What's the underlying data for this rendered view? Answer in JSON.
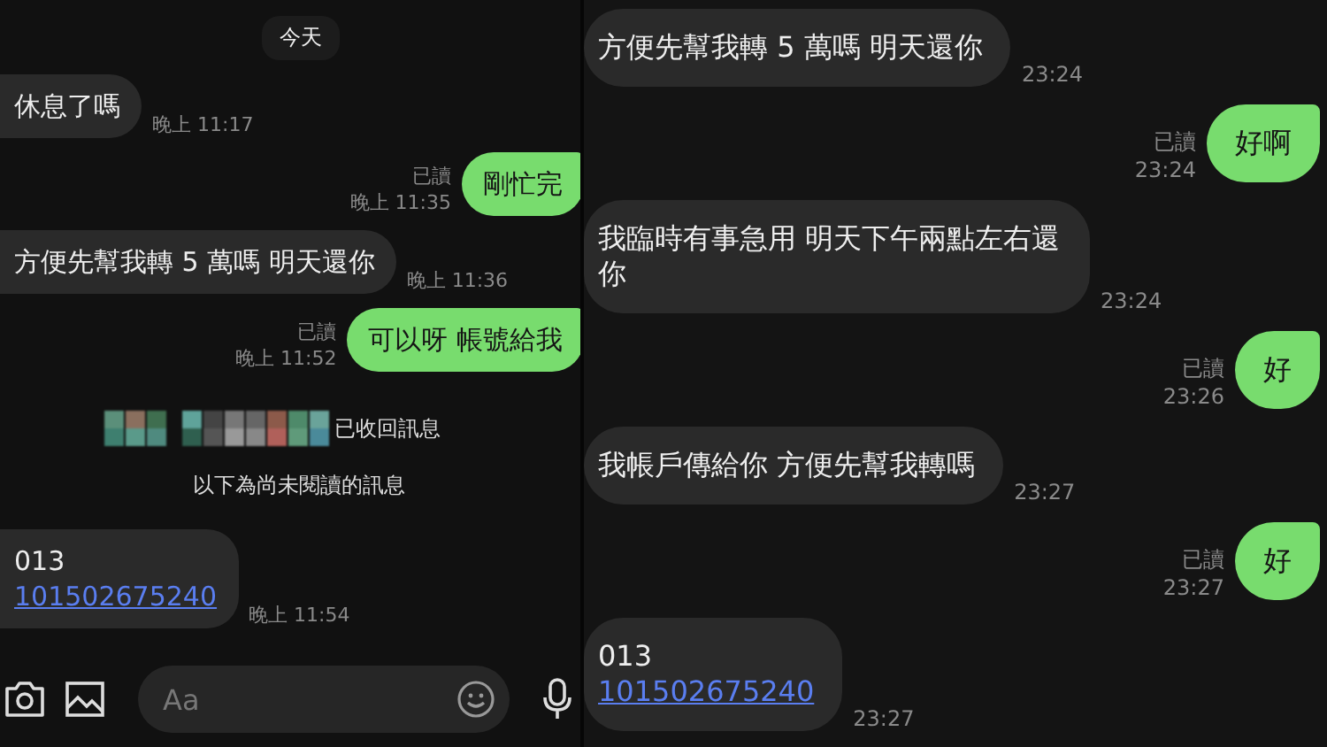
{
  "left_chat": {
    "messages": [
      {
        "kind": "date",
        "text": "今天"
      },
      {
        "kind": "received",
        "text": "休息了嗎",
        "time": "晚上 11:17"
      },
      {
        "kind": "sent",
        "text": "剛忙完",
        "read_label": "已讀",
        "time": "晚上 11:35"
      },
      {
        "kind": "received",
        "text": "方便先幫我轉 5 萬嗎 明天還你",
        "time": "晚上 11:36"
      },
      {
        "kind": "sent",
        "text": "可以呀 帳號給我",
        "read_label": "已讀",
        "time": "晚上 11:52"
      },
      {
        "kind": "recall",
        "text": "已收回訊息"
      },
      {
        "kind": "divider",
        "text": "以下為尚未閱讀的訊息"
      },
      {
        "kind": "received",
        "text": "013",
        "link": "101502675240",
        "time": "晚上 11:54"
      }
    ],
    "input": {
      "placeholder": "Aa"
    }
  },
  "right_chat": {
    "messages": [
      {
        "kind": "received",
        "text": "方便先幫我轉 5 萬嗎 明天還你",
        "time": "23:24"
      },
      {
        "kind": "sent",
        "text": "好啊",
        "read_label": "已讀",
        "time": "23:24"
      },
      {
        "kind": "received",
        "text": "我臨時有事急用 明天下午兩點左右還你",
        "time": "23:24"
      },
      {
        "kind": "sent",
        "text": "好",
        "read_label": "已讀",
        "time": "23:26"
      },
      {
        "kind": "received",
        "text": "我帳戶傳給你 方便先幫我轉嗎",
        "time": "23:27"
      },
      {
        "kind": "sent",
        "text": "好",
        "read_label": "已讀",
        "time": "23:27"
      },
      {
        "kind": "received",
        "text": "013",
        "link": "101502675240",
        "time": "23:27"
      }
    ]
  }
}
